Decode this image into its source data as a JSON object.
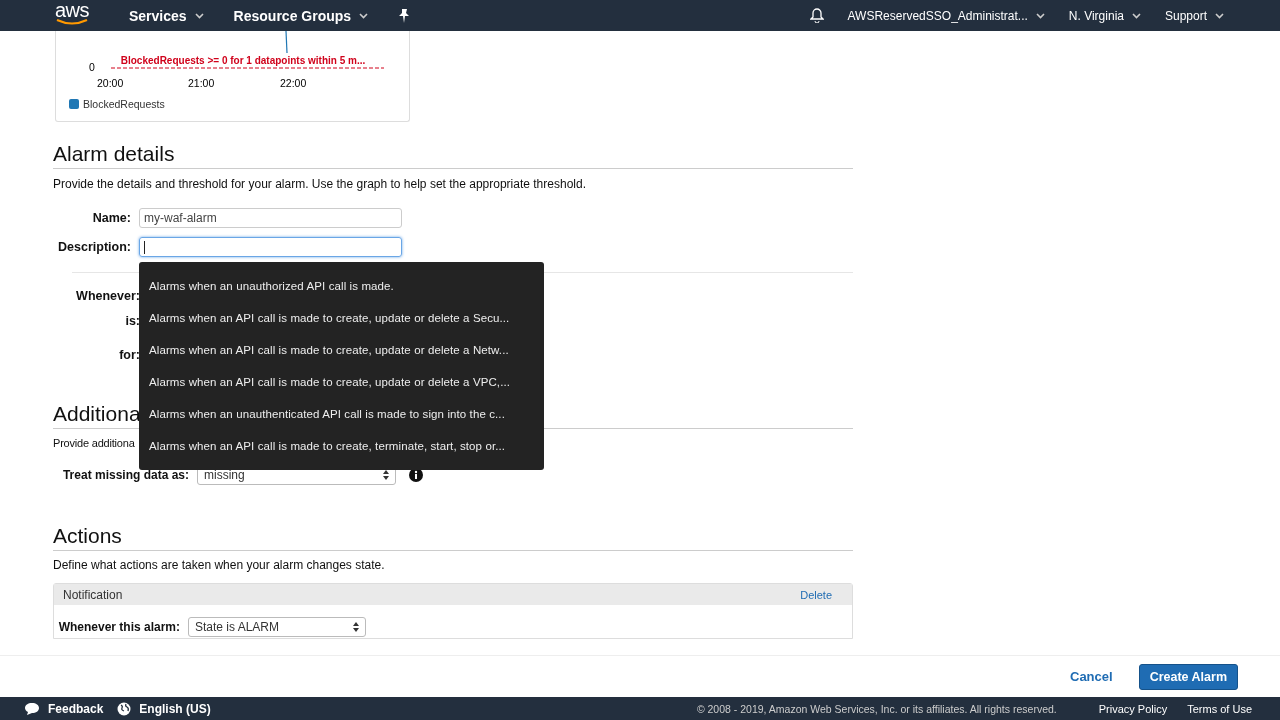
{
  "nav": {
    "logo": "aws",
    "services": "Services",
    "resource_groups": "Resource Groups",
    "account": "AWSReservedSSO_Administrat...",
    "region": "N. Virginia",
    "support": "Support"
  },
  "chart": {
    "y_tick": "0",
    "x_labels": [
      "20:00",
      "21:00",
      "22:00"
    ],
    "threshold_label": "BlockedRequests >= 0 for 1 datapoints within 5 m...",
    "legend": "BlockedRequests"
  },
  "alarm_details": {
    "heading": "Alarm details",
    "description": "Provide the details and threshold for your alarm. Use the graph to help set the appropriate threshold.",
    "fields": [
      {
        "label": "Name:",
        "value": "my-waf-alarm",
        "focused": false
      },
      {
        "label": "Description:",
        "focused": true
      }
    ],
    "condition_labels": [
      "Whenever:",
      "is:",
      "for:"
    ]
  },
  "suggestions": [
    "Alarms when an unauthorized API call is made.",
    "Alarms when an API call is made to create, update or delete a Secu...",
    "Alarms when an API call is made to create, update or delete a Netw...",
    "Alarms when an API call is made to create, update or delete a VPC,...",
    "Alarms when an unauthenticated API call is made to sign into the c...",
    "Alarms when an API call is made to create, terminate, start, stop or..."
  ],
  "additional": {
    "heading": "Additiona",
    "description": "Provide additiona",
    "missing_data": {
      "label": "Treat missing data as:",
      "value": "missing"
    }
  },
  "actions": {
    "heading": "Actions",
    "description": "Define what actions are taken when your alarm changes state.",
    "notification": {
      "title": "Notification",
      "delete": "Delete",
      "rows": [
        {
          "label": "Whenever this alarm:",
          "value": "State is ALARM"
        }
      ]
    }
  },
  "buttons": {
    "cancel": "Cancel",
    "create": "Create Alarm"
  },
  "footer": {
    "feedback": "Feedback",
    "language": "English (US)",
    "copyright": "© 2008 - 2019, Amazon Web Services, Inc. or its affiliates. All rights reserved.",
    "privacy": "Privacy Policy",
    "terms": "Terms of Use"
  }
}
